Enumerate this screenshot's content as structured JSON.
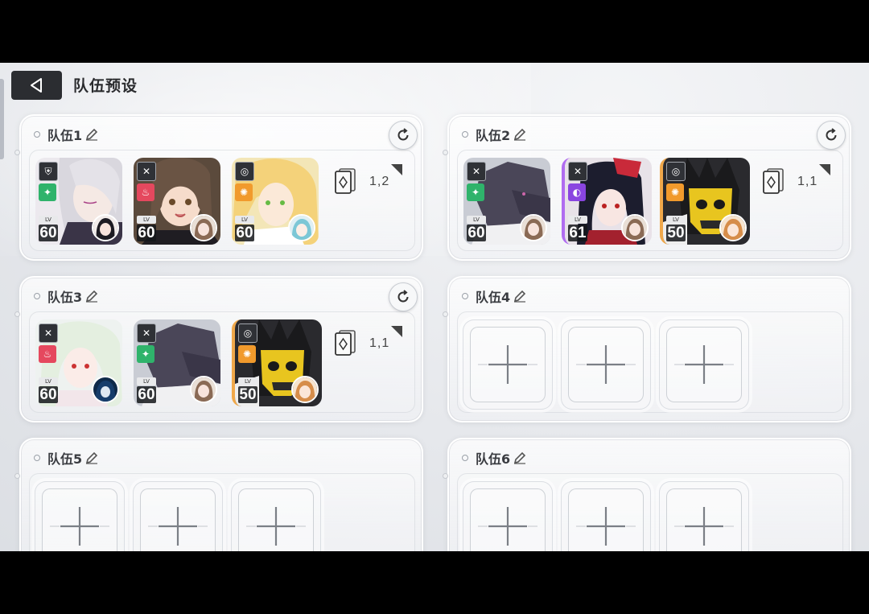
{
  "header": {
    "title": "队伍预设"
  },
  "teams": [
    {
      "name": "队伍1",
      "deck_value": "1,2",
      "members": [
        {
          "level": "60",
          "lv_label": "LV"
        },
        {
          "level": "60",
          "lv_label": "LV"
        },
        {
          "level": "60",
          "lv_label": "LV"
        }
      ]
    },
    {
      "name": "队伍2",
      "deck_value": "1,1",
      "members": [
        {
          "level": "60",
          "lv_label": "LV"
        },
        {
          "level": "61",
          "lv_label": "LV"
        },
        {
          "level": "50",
          "lv_label": "LV"
        }
      ]
    },
    {
      "name": "队伍3",
      "deck_value": "1,1",
      "members": [
        {
          "level": "60",
          "lv_label": "LV"
        },
        {
          "level": "60",
          "lv_label": "LV"
        },
        {
          "level": "50",
          "lv_label": "LV"
        }
      ]
    },
    {
      "name": "队伍4"
    },
    {
      "name": "队伍5"
    },
    {
      "name": "队伍6"
    }
  ],
  "colors": {
    "element_green": "#2fb36b",
    "element_red": "#e5485e",
    "element_orange": "#f19a2c",
    "element_purple": "#8a45e0",
    "header_button": "#2b2d31"
  }
}
